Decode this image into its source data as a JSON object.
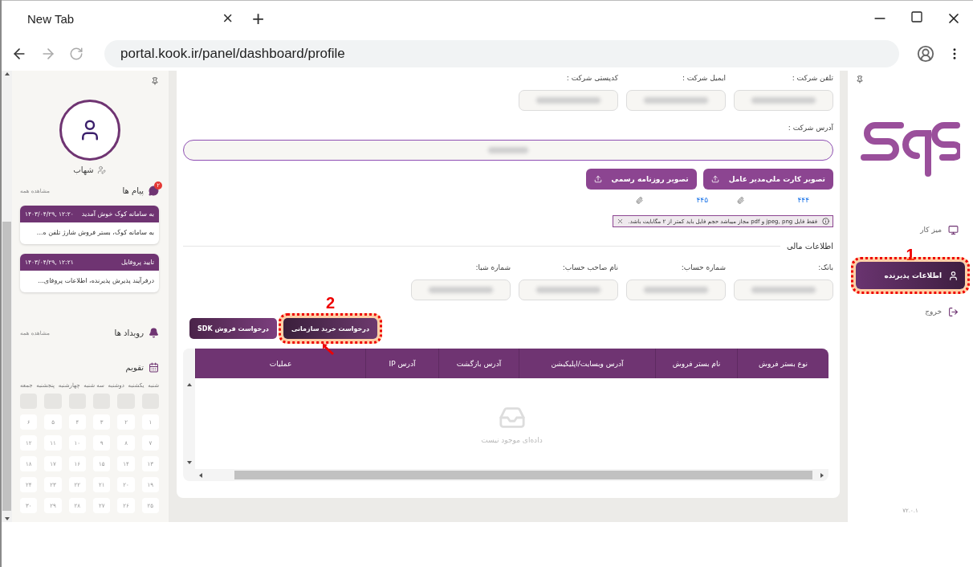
{
  "browser": {
    "tab_title": "New Tab",
    "tab_close": "×",
    "new_tab": "+",
    "url": "portal.kook.ir/panel/dashboard/profile"
  },
  "left_panel": {
    "user_name": "شهاب",
    "messages": {
      "title": "پیام ها",
      "badge": "۲",
      "see_all": "مشاهده همه",
      "items": [
        {
          "title": "به سامانه کوک خوش آمدید",
          "time": "۱۴۰۳/۰۴/۲۹, ۱۲:۲۰",
          "body": "به سامانه کوک، بستر فروش شارژ تلفن ه..."
        },
        {
          "title": "تایید پروفایل",
          "time": "۱۴۰۳/۰۴/۲۹, ۱۲:۲۱",
          "body": "درفرآیند پذیرش پذیرنده، اطلاعات پروفای..."
        }
      ]
    },
    "events": {
      "title": "رویداد ها",
      "see_all": "مشاهده همه"
    },
    "calendar": {
      "title": "تقویم",
      "weekdays": [
        "شنبه",
        "یکشنبه",
        "دوشنبه",
        "سه شنبه",
        "چهارشنبه",
        "پنجشنبه",
        "جمعه"
      ],
      "days": [
        {
          "kind": "blank"
        },
        {
          "kind": "blank"
        },
        {
          "kind": "blank"
        },
        {
          "kind": "blank"
        },
        {
          "kind": "blank"
        },
        {
          "kind": "blank"
        },
        {
          "kind": "day",
          "label": "۱"
        },
        {
          "kind": "day",
          "label": "۲"
        },
        {
          "kind": "day",
          "label": "۳"
        },
        {
          "kind": "day",
          "label": "۴"
        },
        {
          "kind": "day",
          "label": "۵"
        },
        {
          "kind": "day",
          "label": "۶"
        },
        {
          "kind": "day",
          "label": "۷"
        },
        {
          "kind": "day",
          "label": "۸"
        },
        {
          "kind": "day",
          "label": "۹"
        },
        {
          "kind": "day",
          "label": "۱۰"
        },
        {
          "kind": "day",
          "label": "۱۱"
        },
        {
          "kind": "day",
          "label": "۱۲"
        },
        {
          "kind": "day",
          "label": "۱۳"
        },
        {
          "kind": "day",
          "label": "۱۴"
        },
        {
          "kind": "day",
          "label": "۱۵"
        },
        {
          "kind": "day",
          "label": "۱۶"
        },
        {
          "kind": "day",
          "label": "۱۷"
        },
        {
          "kind": "day",
          "label": "۱۸"
        },
        {
          "kind": "day",
          "label": "۱۹"
        },
        {
          "kind": "day",
          "label": "۲۰"
        },
        {
          "kind": "day",
          "label": "۲۱"
        },
        {
          "kind": "day",
          "label": "۲۲"
        },
        {
          "kind": "day",
          "label": "۲۳"
        },
        {
          "kind": "day",
          "label": "۲۴"
        },
        {
          "kind": "day",
          "label": "۲۵"
        },
        {
          "kind": "day",
          "label": "۲۶"
        },
        {
          "kind": "day",
          "label": "۲۷"
        },
        {
          "kind": "day",
          "label": "۲۸"
        },
        {
          "kind": "day",
          "label": "۲۹"
        },
        {
          "kind": "day",
          "label": "۳۰"
        }
      ]
    }
  },
  "main": {
    "company_fields": [
      {
        "label": "تلفن شرکت :"
      },
      {
        "label": "ایمیل شرکت :"
      },
      {
        "label": "کدپستی شرکت :"
      }
    ],
    "address": {
      "label": "آدرس شرکت :"
    },
    "uploads": [
      {
        "label": "تصویر کارت ملی‌مدیر عامل",
        "file": "۴۴۴"
      },
      {
        "label": "تصویر روزنامه رسمی",
        "file": "۴۴۵"
      }
    ],
    "notice": "فقط فایل jpeg, png و pdf مجاز میباشد حجم فایل باید کمتر از ۲ مگابایت باشد.",
    "financial": {
      "title": "اطلاعات مالی",
      "fields": [
        {
          "label": "بانک:"
        },
        {
          "label": "شماره حساب:"
        },
        {
          "label": "نام صاحب حساب:"
        },
        {
          "label": "شماره شبا:"
        }
      ]
    },
    "request_tabs": [
      {
        "label": "درخواست خرید سازمانی",
        "selected": true,
        "callout": "2"
      },
      {
        "label": "درخواست فروش SDK",
        "selected": false
      }
    ],
    "table": {
      "columns": [
        "نوع بستر فروش",
        "نام بستر فروش",
        "آدرس وبسایت/اپلیکیشن",
        "آدرس بازگشت",
        "آدرس IP",
        "عملیات"
      ],
      "empty_text": "داده‌ای موجود نیست"
    }
  },
  "sidebar": {
    "items": [
      {
        "kind": "desk",
        "label": "میز کار",
        "selected": false
      },
      {
        "kind": "user",
        "label": "اطلاعات پذیرنده",
        "selected": true,
        "callout": "1"
      },
      {
        "kind": "logout",
        "label": "خروج",
        "selected": false
      }
    ],
    "version": "۷۲.۰.۱"
  }
}
